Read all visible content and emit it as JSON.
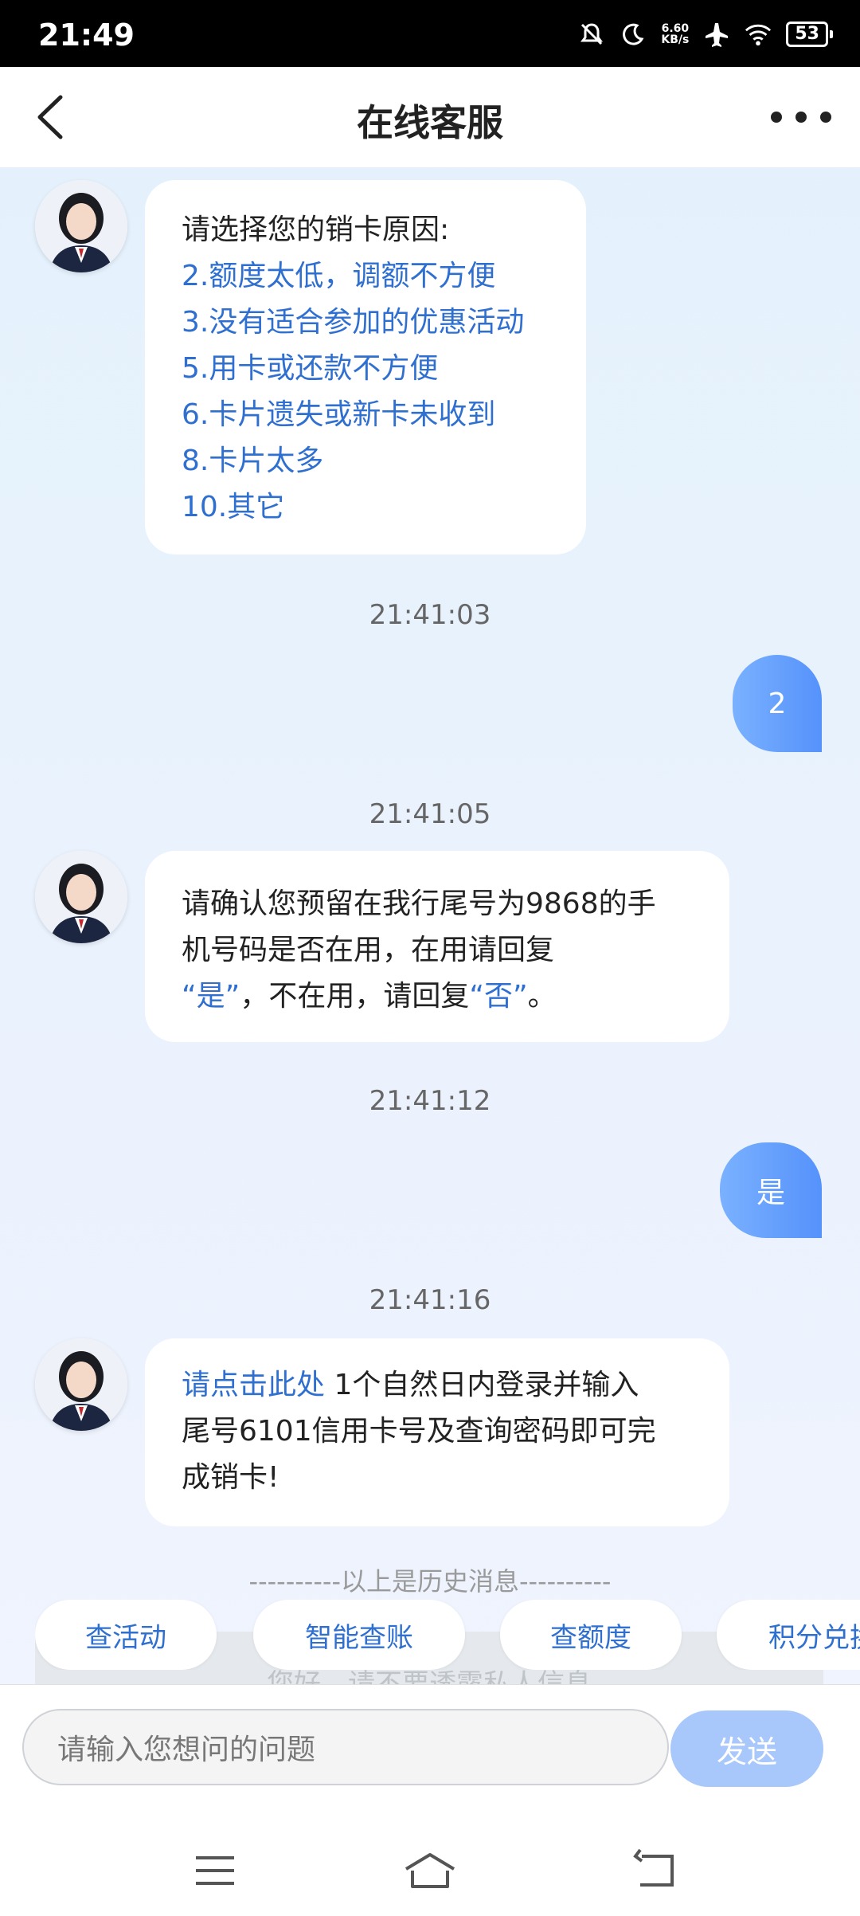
{
  "status_bar": {
    "time": "21:49",
    "net_speed_value": "6.60",
    "net_speed_unit": "KB/s",
    "battery": "53"
  },
  "header": {
    "title": "在线客服"
  },
  "messages": {
    "m1": {
      "intro": "请选择您的销卡原因:",
      "options": [
        "2.额度太低，调额不方便",
        "3.没有适合参加的优惠活动",
        "5.用卡或还款不方便",
        "6.卡片遗失或新卡未收到",
        "8.卡片太多",
        "10.其它"
      ]
    },
    "t1": "21:41:03",
    "r1": "2",
    "t2": "21:41:05",
    "m2": {
      "line1": "请确认您预留在我行尾号为9868的手",
      "line2": "机号码是否在用，在用请回复",
      "q_yes": "“是”",
      "mid": "，不在用，请回复",
      "q_no": "“否”",
      "end": "。"
    },
    "t3": "21:41:12",
    "r2": "是",
    "t4": "21:41:16",
    "m3": {
      "link": "请点击此处",
      "line1_rest": " 1个自然日内登录并输入",
      "line2": "尾号6101信用卡号及查询密码即可完",
      "line3": "成销卡!"
    }
  },
  "history_divider": "----------以上是历史消息----------",
  "notice": "您好，请不要透露私人信息",
  "chips": [
    "查活动",
    "智能查账",
    "查额度",
    "积分兑换"
  ],
  "input": {
    "placeholder": "请输入您想问的问题",
    "send_label": "发送"
  },
  "icons": {
    "back": "back-arrow-icon",
    "more": "more-dots-icon",
    "nav_menu": "menu-icon",
    "nav_home": "home-icon",
    "nav_back": "back-icon"
  },
  "colors": {
    "accent": "#2f6fd0",
    "bubble_user": "#5592fb",
    "send_disabled": "#a8c7fb"
  }
}
